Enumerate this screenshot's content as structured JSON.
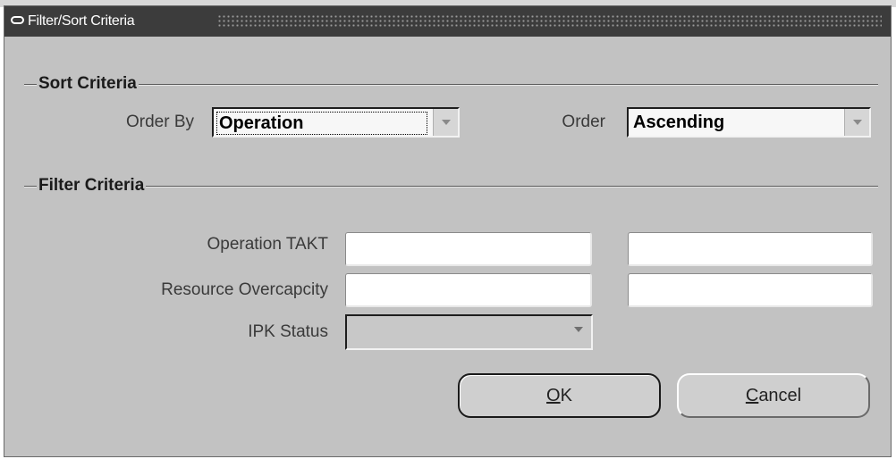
{
  "window": {
    "title": "Filter/Sort Criteria"
  },
  "sort_criteria": {
    "section_title": "Sort Criteria",
    "order_by_label": "Order By",
    "order_by_value": "Operation",
    "order_label": "Order",
    "order_value": "Ascending"
  },
  "filter_criteria": {
    "section_title": "Filter Criteria",
    "operation_takt_label": "Operation TAKT",
    "operation_takt_from": "",
    "operation_takt_to": "",
    "resource_overcapacity_label": "Resource Overcapcity",
    "resource_overcapacity_from": "",
    "resource_overcapacity_to": "",
    "ipk_status_label": "IPK Status",
    "ipk_status_value": ""
  },
  "buttons": {
    "ok_mnemonic": "O",
    "ok_rest": "K",
    "cancel_mnemonic": "C",
    "cancel_rest": "ancel"
  },
  "colors": {
    "titlebar": "#3c3c3c",
    "window_bg": "#c2c2c2",
    "field_bg": "#ffffff"
  },
  "icons": {
    "window_menu": "window-menu-icon",
    "dropdown": "chevron-down-icon"
  }
}
